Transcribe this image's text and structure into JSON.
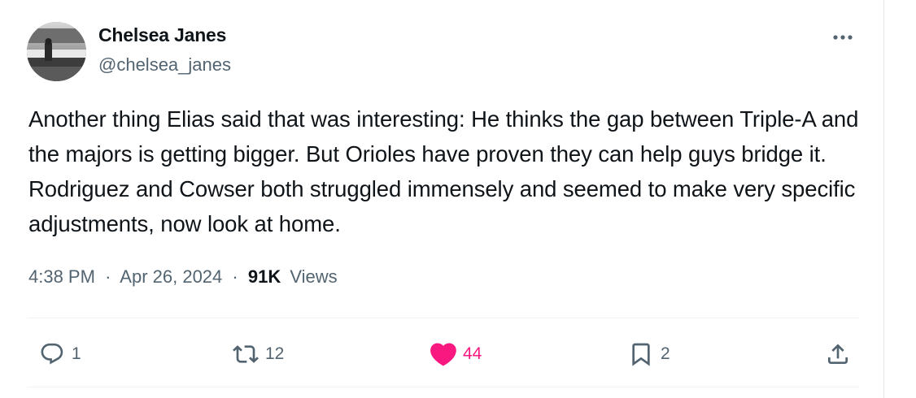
{
  "author": {
    "name": "Chelsea Janes",
    "handle": "@chelsea_janes"
  },
  "tweet": {
    "text": "Another thing Elias said that was interesting: He thinks the gap between Triple-A and the majors is getting bigger. But Orioles have proven they can help guys bridge it. Rodriguez and Cowser both struggled immensely and seemed to make very specific adjustments, now look at home."
  },
  "meta": {
    "time": "4:38 PM",
    "separator": "·",
    "date": "Apr 26, 2024",
    "views_count": "91K",
    "views_label": "Views"
  },
  "actions": {
    "replies": "1",
    "reposts": "12",
    "likes": "44",
    "bookmarks": "2"
  },
  "icons": {
    "more": "more-horizontal-icon",
    "reply": "reply-icon",
    "repost": "repost-icon",
    "like": "heart-filled-icon",
    "bookmark": "bookmark-icon",
    "share": "share-icon"
  },
  "colors": {
    "text_primary": "#0f1419",
    "text_secondary": "#536471",
    "like_active": "#f91880",
    "divider": "#eff3f4"
  }
}
